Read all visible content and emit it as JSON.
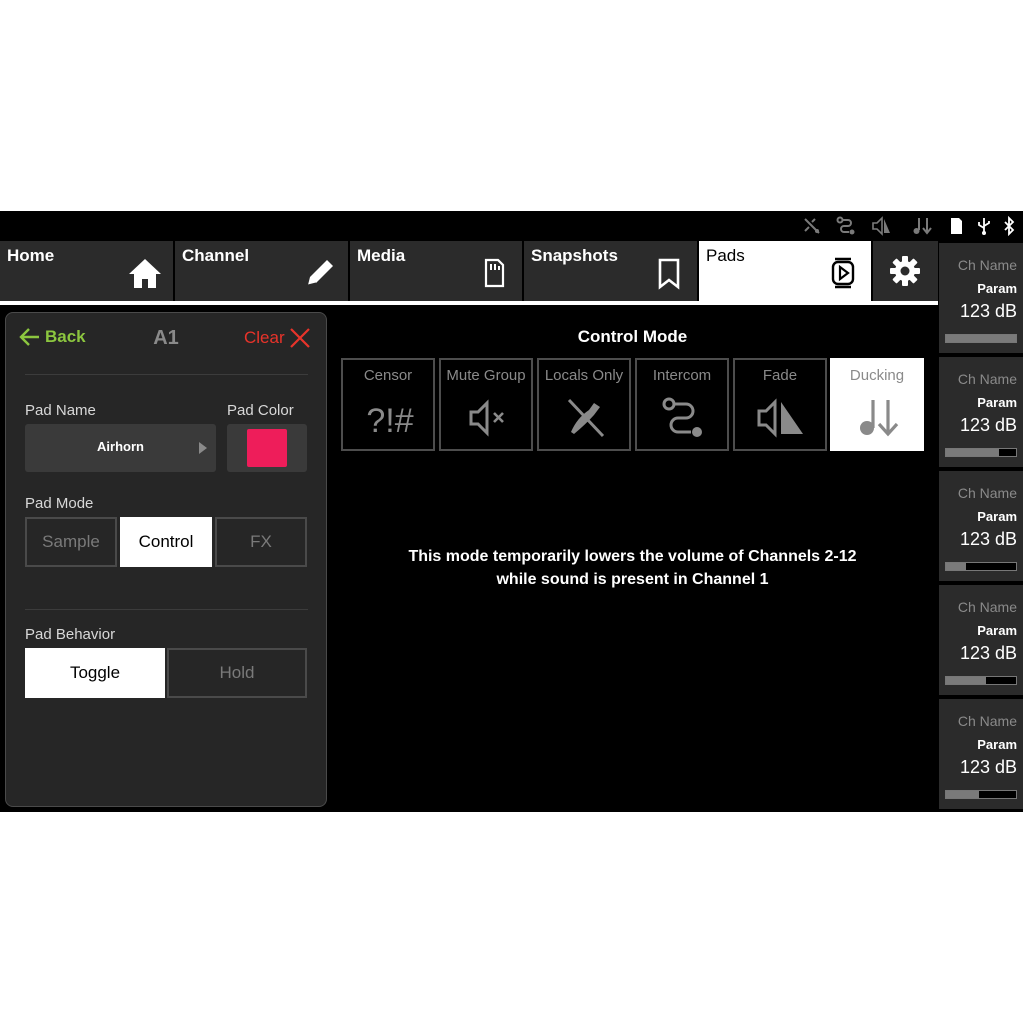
{
  "status_icons": [
    "intercom-muted-icon",
    "intercom-icon",
    "fade-icon",
    "ducking-icon",
    "sd-card-icon",
    "usb-icon",
    "bluetooth-icon"
  ],
  "nav": {
    "tabs": [
      {
        "label": "Home",
        "icon": "home-icon"
      },
      {
        "label": "Channel",
        "icon": "pencil-icon"
      },
      {
        "label": "Media",
        "icon": "sd-card-icon"
      },
      {
        "label": "Snapshots",
        "icon": "bookmark-icon"
      },
      {
        "label": "Pads",
        "icon": "pad-play-icon"
      }
    ],
    "active_tab": "Pads",
    "settings_icon": "gear-icon"
  },
  "pad_panel": {
    "back_label": "Back",
    "pad_id": "A1",
    "clear_label": "Clear",
    "pad_name_label": "Pad Name",
    "pad_name_value": "Airhorn",
    "pad_color_label": "Pad Color",
    "pad_color": "#ee1d5a",
    "pad_mode_label": "Pad Mode",
    "pad_modes": [
      "Sample",
      "Control",
      "FX"
    ],
    "pad_mode_selected": "Control",
    "pad_behavior_label": "Pad Behavior",
    "pad_behaviors": [
      "Toggle",
      "Hold"
    ],
    "pad_behavior_selected": "Toggle"
  },
  "control_mode": {
    "title": "Control Mode",
    "modes": [
      {
        "label": "Censor",
        "icon": "censor-icon"
      },
      {
        "label": "Mute Group",
        "icon": "mute-icon"
      },
      {
        "label": "Locals Only",
        "icon": "locals-only-icon"
      },
      {
        "label": "Intercom",
        "icon": "intercom-icon"
      },
      {
        "label": "Fade",
        "icon": "fade-icon"
      },
      {
        "label": "Ducking",
        "icon": "ducking-icon"
      }
    ],
    "selected": "Ducking",
    "description_line1": "This mode temporarily lowers the volume of Channels 2-12",
    "description_line2": "while sound is present in Channel 1"
  },
  "channel_strips": [
    {
      "name": "Ch Name",
      "param": "Param",
      "value": "123 dB",
      "level": 1.0
    },
    {
      "name": "Ch Name",
      "param": "Param",
      "value": "123 dB",
      "level": 0.76
    },
    {
      "name": "Ch Name",
      "param": "Param",
      "value": "123 dB",
      "level": 0.28
    },
    {
      "name": "Ch Name",
      "param": "Param",
      "value": "123 dB",
      "level": 0.57
    },
    {
      "name": "Ch Name",
      "param": "Param",
      "value": "123 dB",
      "level": 0.47
    }
  ],
  "colors": {
    "accent_green": "#8cc63f",
    "clear_red": "#e8332a",
    "pad_color": "#ee1d5a"
  }
}
